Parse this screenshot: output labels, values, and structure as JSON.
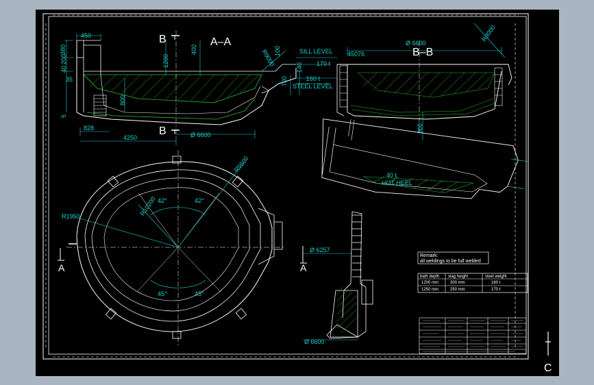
{
  "views": {
    "section_aa": "A–A",
    "section_bb": "B–B",
    "cut_b": "B",
    "cut_a": "A",
    "cut_c": "C"
  },
  "dims_aa": {
    "d450": "450",
    "d380": "380",
    "d40": "40",
    "d200": "200",
    "d1200": "1200",
    "d400": "400",
    "r9000": "R9000",
    "d100": "100",
    "d140": "140",
    "d700": "700",
    "d35": "35",
    "d800": "800",
    "d5": "5",
    "d828": "828",
    "d4250": "4250",
    "dia6600": "Ø 6600"
  },
  "levels": {
    "sill": "SILL LEVEL",
    "steel": "STEEL LEVEL",
    "t170": "170 t",
    "t160": "160 t",
    "t40_hot": "40 t",
    "hot_heel": "HOT HEEL",
    "d45076": "45076"
  },
  "dims_bb": {
    "dia6600": "Ø 6600",
    "r9000": "R9000",
    "d800": "800"
  },
  "plan": {
    "r1950": "R1950",
    "r5500": "R5500",
    "r10200": "R10200",
    "a42a": "42°",
    "a42b": "42°",
    "a45a": "45°",
    "a45b": "45°"
  },
  "detail": {
    "dia6257": "Ø 6257",
    "dia6600": "Ø 6600"
  },
  "remark": {
    "title": "Remark:",
    "text": "all weldings to be full welded"
  },
  "table": {
    "headers": [
      "bath depth",
      "slag height",
      "steel weight"
    ],
    "rows": [
      [
        "1200 mm",
        "300 mm",
        "160 t"
      ],
      [
        "1250 mm",
        "250 mm",
        "170 t"
      ]
    ]
  }
}
